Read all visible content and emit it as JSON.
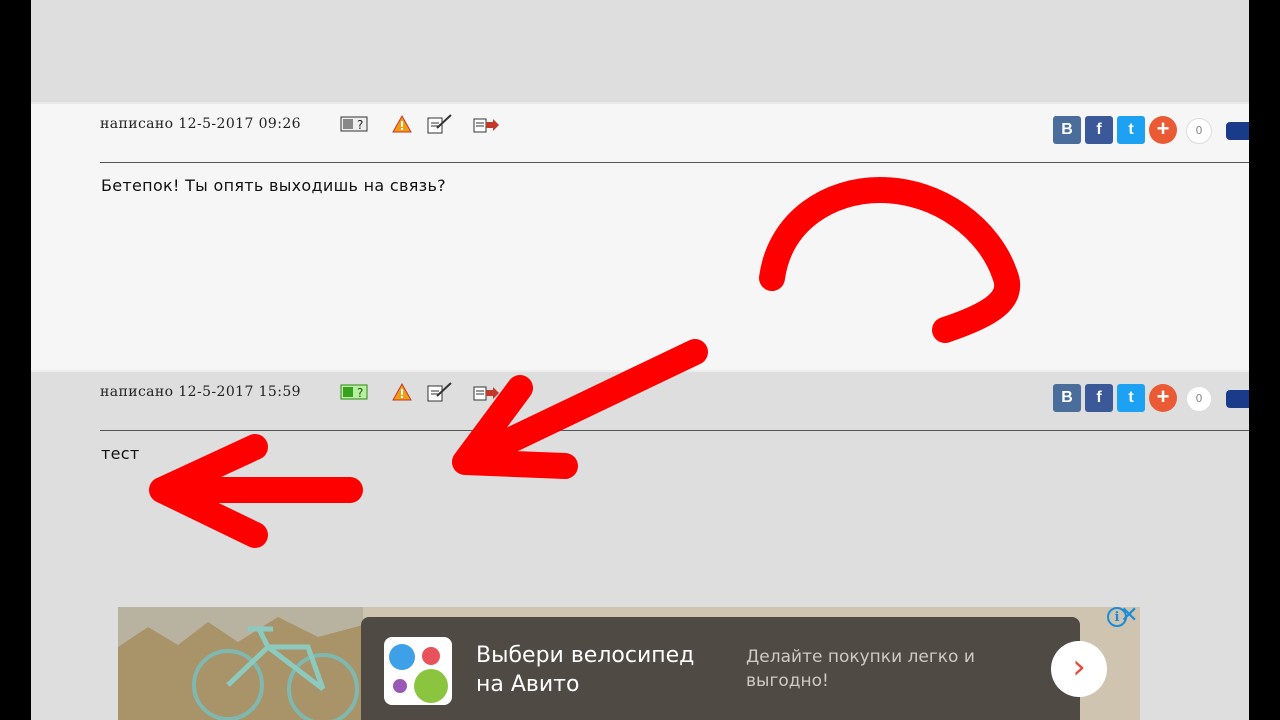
{
  "posts": [
    {
      "meta": "написано 12-5-2017 09:26",
      "text": "Бетепок! Ты опять выходишь на связь?",
      "share": {
        "vk": "B",
        "fb": "f",
        "tw": "t",
        "more": "+",
        "count": "0"
      }
    },
    {
      "meta": "написано 12-5-2017 15:59",
      "text": "тест",
      "share": {
        "vk": "B",
        "fb": "f",
        "tw": "t",
        "more": "+",
        "count": "0"
      }
    }
  ],
  "ad": {
    "title": "Выбери велосипед на Авито",
    "subtitle": "Делайте покупки легко и выгодно!",
    "arrow": "›",
    "info": "i",
    "close": "✕"
  },
  "colors": {
    "annotation": "#ff0000",
    "vk": "#4a6d9c",
    "facebook": "#3b5998",
    "twitter": "#1da1f2",
    "share_more": "#ea5b35",
    "ad_accent": "#1a8cd8"
  },
  "icons": [
    "quote-icon",
    "warning-icon",
    "edit-icon",
    "reply-icon",
    "vk-icon",
    "facebook-icon",
    "twitter-icon",
    "add-share-icon",
    "info-icon",
    "close-icon"
  ]
}
